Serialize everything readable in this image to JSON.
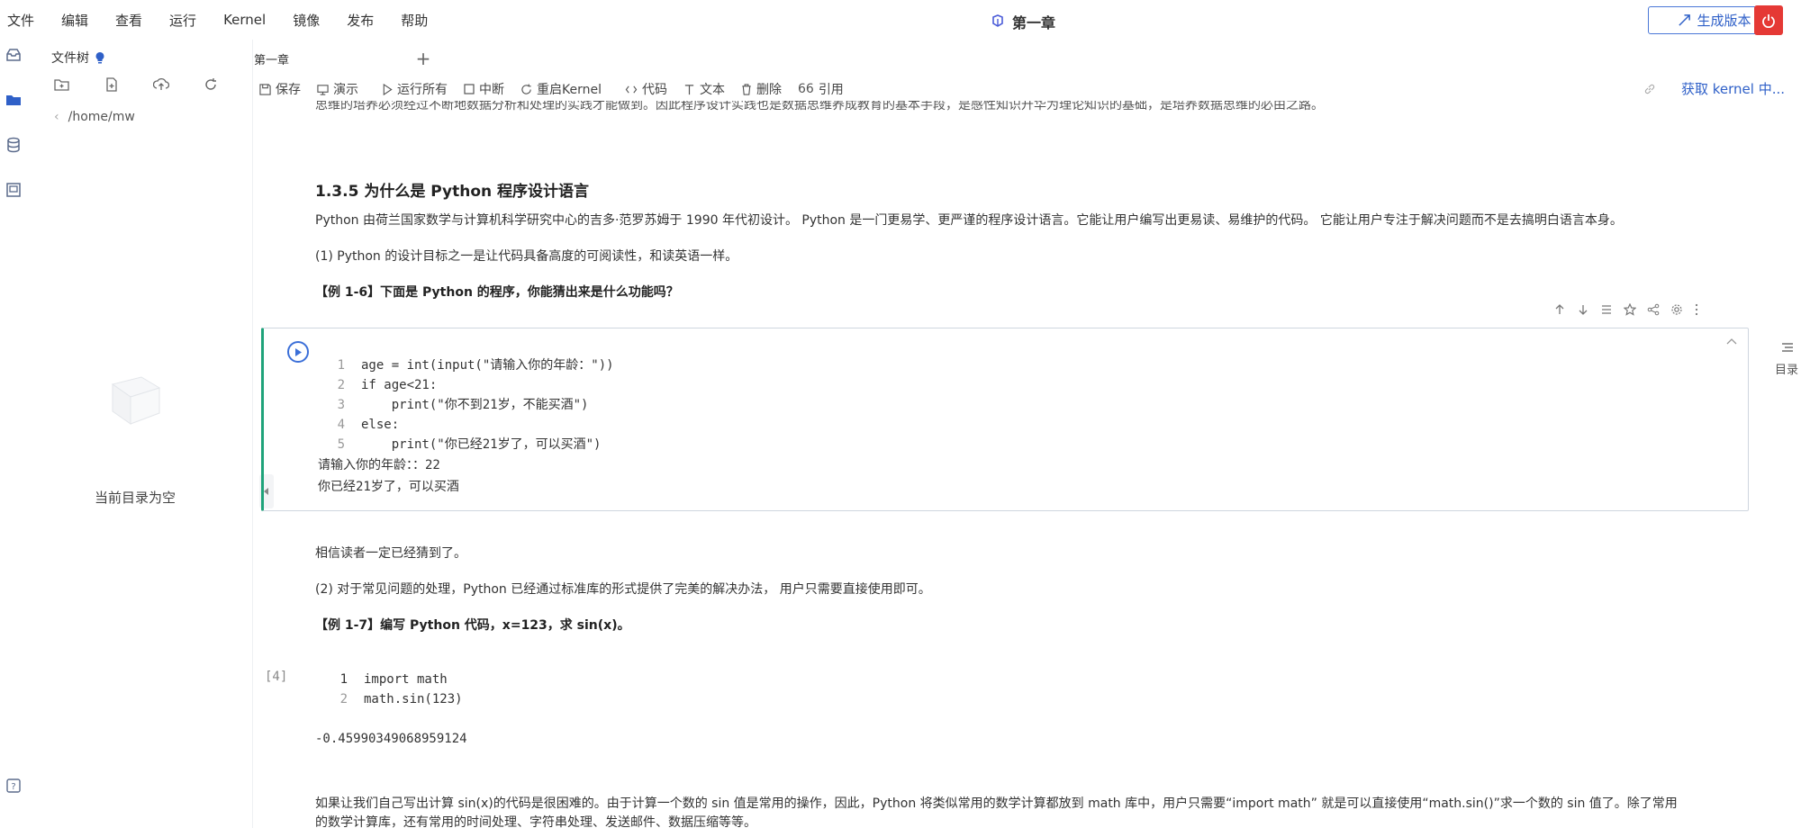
{
  "menubar": {
    "items": [
      "文件",
      "编辑",
      "查看",
      "运行",
      "Kernel",
      "镜像",
      "发布",
      "帮助"
    ],
    "doc_title": "第一章",
    "generate_label": "生成版本"
  },
  "file_panel": {
    "title": "文件树",
    "path": "/home/mw",
    "empty_text": "当前目录为空"
  },
  "tabs": [
    {
      "label": "第一章"
    }
  ],
  "toolbar": {
    "save": "保存",
    "present": "演示",
    "run_all": "运行所有",
    "interrupt": "中断",
    "restart": "重启Kernel",
    "code": "代码",
    "text": "文本",
    "delete": "删除",
    "cite": "引用",
    "kernel_status": "获取 kernel 中..."
  },
  "notebook": {
    "intro_line": "思维的培养必须经过不断地数据分析和处理的实践才能做到。因此程序设计实践也是数据思维养成教育的基本手段，是感性知识升华为理论知识的基础，是培养数据思维的必由之路。",
    "section_title": "1.3.5 为什么是 Python 程序设计语言",
    "para1": "Python 由荷兰国家数学与计算机科学研究中心的吉多·范罗苏姆于 1990 年代初设计。 Python 是一门更易学、更严谨的程序设计语言。它能让用户编写出更易读、易维护的代码。 它能让用户专注于解决问题而不是去搞明白语言本身。",
    "para2": "(1) Python 的设计目标之一是让代码具备高度的可阅读性，和读英语一样。",
    "example1": "【例 1-6】下面是 Python 的程序，你能猜出来是什么功能吗？",
    "cell1": {
      "lines": [
        {
          "n": "1",
          "t": "age = int(input(\"请输入你的年龄：\"))"
        },
        {
          "n": "2",
          "t": "if age<21:"
        },
        {
          "n": "3",
          "t": "    print(\"你不到21岁，不能买酒\")"
        },
        {
          "n": "4",
          "t": "else:"
        },
        {
          "n": "5",
          "t": "    print(\"你已经21岁了，可以买酒\")"
        }
      ],
      "output1": "请输入你的年龄：：22",
      "output2": "你已经21岁了，可以买酒"
    },
    "para3": "相信读者一定已经猜到了。",
    "para4": "(2) 对于常见问题的处理，Python 已经通过标准库的形式提供了完美的解决办法， 用户只需要直接使用即可。",
    "example2": "【例 1-7】编写 Python 代码，x=123，求 sin(x)。",
    "cell2": {
      "exec_count": "[4]",
      "line1_num": "1",
      "line1": "import math",
      "line2_num": "2",
      "line2": "math.sin(123)",
      "output": "-0.45990349068959124"
    },
    "para5a": "如果让我们自己写出计算 sin(x)的代码是很困难的。由于计算一个数的 sin 值是常用的操作，因此，Python 将类似常用的数学计算都放到 math 库中，用户只需要“import math” 就是可以直接使用“math.sin()”求一个数的 sin 值了。除了常用",
    "para5b": "的数学计算库，还有常用的时间处理、字符串处理、发送邮件、数据压缩等等。"
  },
  "right_panel": {
    "toc_label": "目录"
  },
  "colors": {
    "accent": "#2f60c8",
    "cell_active_border": "#1fa37a",
    "danger": "#e53935"
  }
}
